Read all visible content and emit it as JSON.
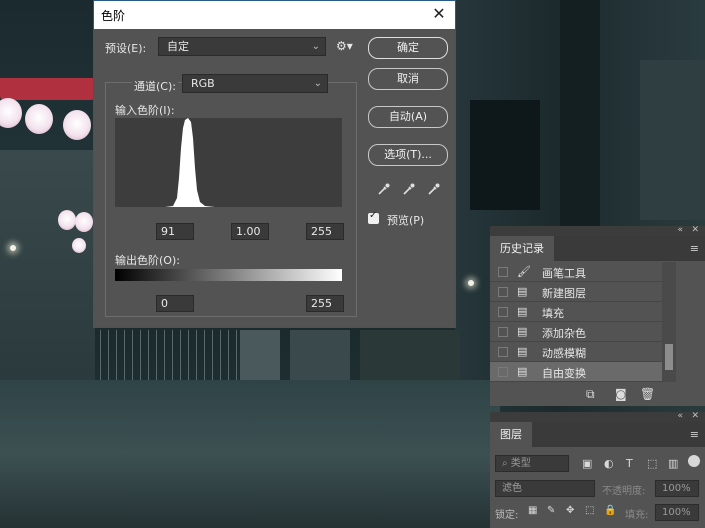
{
  "dialog": {
    "title": "色阶",
    "preset_label": "预设(E):",
    "preset_value": "自定",
    "channel_label": "通道(C):",
    "channel_value": "RGB",
    "input_levels_label": "输入色阶(I):",
    "output_levels_label": "输出色阶(O):",
    "input_black": "91",
    "input_gamma": "1.00",
    "input_white": "255",
    "output_black": "0",
    "output_white": "255",
    "buttons": {
      "ok": "确定",
      "cancel": "取消",
      "auto": "自动(A)",
      "options": "选项(T)..."
    },
    "preview_label": "预览(P)",
    "preview_checked": true,
    "icons": {
      "close": "close-icon",
      "gear": "gear-icon",
      "black_eyedropper": "black-eyedropper-icon",
      "gray_eyedropper": "gray-eyedropper-icon",
      "white_eyedropper": "white-eyedropper-icon"
    }
  },
  "history": {
    "tab_label": "历史记录",
    "items": [
      {
        "label": "画笔工具",
        "icon": "brush-icon"
      },
      {
        "label": "新建图层",
        "icon": "history-step-icon"
      },
      {
        "label": "填充",
        "icon": "history-step-icon"
      },
      {
        "label": "添加杂色",
        "icon": "history-step-icon"
      },
      {
        "label": "动感模糊",
        "icon": "history-step-icon"
      },
      {
        "label": "自由变换",
        "icon": "history-step-icon",
        "selected": true
      }
    ]
  },
  "layers": {
    "tab_label": "图层",
    "filter_label": "类型",
    "blend_mode": "滤色",
    "opacity_label": "不透明度:",
    "opacity_value": "100%",
    "lock_label": "锁定:",
    "fill_label": "填充:",
    "fill_value": "100%"
  },
  "colors": {
    "dialog_bg": "#535353",
    "panel_bg": "#535353",
    "field_bg": "#3a3a3a",
    "title_bg": "#ffffff"
  }
}
